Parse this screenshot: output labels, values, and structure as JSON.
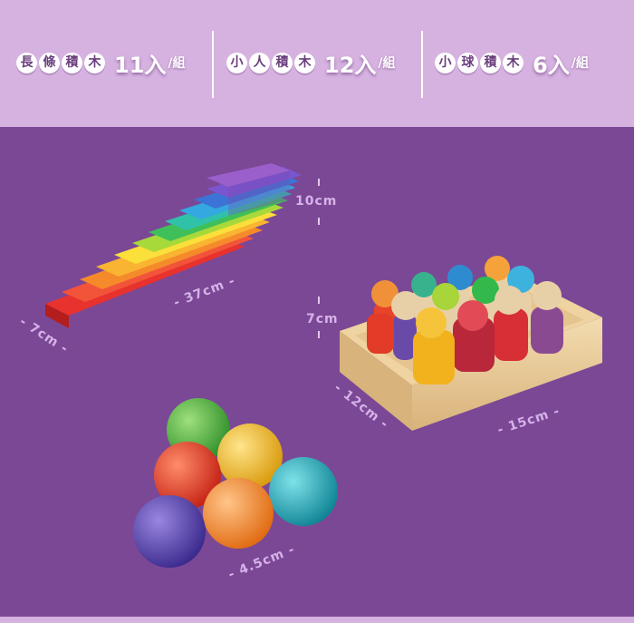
{
  "header": {
    "groups": [
      {
        "chars": [
          "長",
          "條",
          "積",
          "木"
        ],
        "count": "11入",
        "unit": "/組"
      },
      {
        "chars": [
          "小",
          "人",
          "積",
          "木"
        ],
        "count": "12入",
        "unit": "/組"
      },
      {
        "chars": [
          "小",
          "球",
          "積",
          "木"
        ],
        "count": "6入",
        "unit": "/組"
      }
    ]
  },
  "dimensions": {
    "blocks_width": "- 37cm -",
    "blocks_depth": "- 7cm -",
    "blocks_height": "10cm",
    "people_height": "7cm",
    "tray_depth": "- 12cm -",
    "tray_width": "- 15cm -",
    "ball_size": "- 4.5cm -"
  },
  "colors": {
    "header_bg": "#d6b2e0",
    "main_bg": "#7b4896",
    "pill_text": "#6b3f7d"
  }
}
